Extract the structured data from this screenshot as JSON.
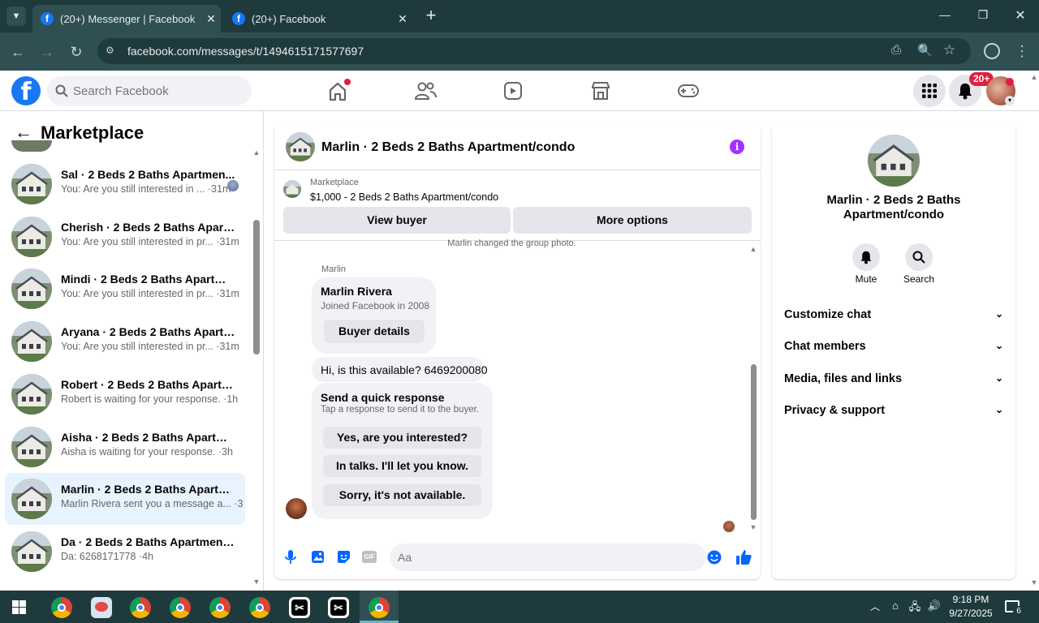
{
  "browser": {
    "tabs": [
      {
        "title": "(20+) Messenger | Facebook",
        "active": true
      },
      {
        "title": "(20+) Facebook",
        "active": false
      }
    ],
    "url": "facebook.com/messages/t/1494615171577697"
  },
  "fb_header": {
    "search_placeholder": "Search Facebook",
    "notification_badge": "20+"
  },
  "marketplace": {
    "title": "Marketplace",
    "conversations": [
      {
        "name": "Sal · 2 Beds 2 Baths Apartmen...",
        "preview": "You: Are you still interested in ... ·31m",
        "selected": false
      },
      {
        "name": "Cherish · 2 Beds 2 Baths Apartm...",
        "preview": "You: Are you still interested in pr... ·31m",
        "selected": false
      },
      {
        "name": "Mindi · 2 Beds 2 Baths Apartme...",
        "preview": "You: Are you still interested in pr... ·31m",
        "selected": false
      },
      {
        "name": "Aryana · 2 Beds 2 Baths Apartm...",
        "preview": "You: Are you still interested in pr... ·31m",
        "selected": false
      },
      {
        "name": "Robert · 2 Beds 2 Baths Apartm...",
        "preview": "Robert is waiting for your response. ·1h",
        "selected": false
      },
      {
        "name": "Aisha · 2 Beds 2 Baths Apartme...",
        "preview": "Aisha is waiting for your response. ·3h",
        "selected": false
      },
      {
        "name": "Marlin · 2 Beds 2 Baths Apartme...",
        "preview": "Marlin Rivera sent you a message a... ·3h",
        "selected": true
      },
      {
        "name": "Da · 2 Beds 2 Baths Apartment/...",
        "preview": "Da: 6268171778 ·4h",
        "selected": false
      }
    ]
  },
  "chat": {
    "title": "Marlin · 2 Beds 2 Baths Apartment/condo",
    "listing_source": "Marketplace",
    "listing_text": "$1,000 - 2 Beds 2 Baths Apartment/condo",
    "view_buyer": "View buyer",
    "more_options": "More options",
    "system_note": "Marlin changed the group photo.",
    "sender_label": "Marlin",
    "profile_name": "Marlin Rivera",
    "profile_joined": "Joined Facebook in 2008",
    "buyer_details": "Buyer details",
    "message": "Hi, is this available? 6469200080",
    "quick_title": "Send a quick response",
    "quick_sub": "Tap a response to send it to the buyer.",
    "quick_replies": [
      "Yes, are you interested?",
      "In talks. I'll let you know.",
      "Sorry, it's not available."
    ],
    "composer_placeholder": "Aa"
  },
  "details": {
    "title": "Marlin · 2 Beds 2 Baths Apartment/condo",
    "mute": "Mute",
    "search": "Search",
    "sections": [
      "Customize chat",
      "Chat members",
      "Media, files and links",
      "Privacy & support"
    ]
  },
  "taskbar": {
    "time": "9:18 PM",
    "date": "9/27/2025",
    "notif_count": "6"
  }
}
